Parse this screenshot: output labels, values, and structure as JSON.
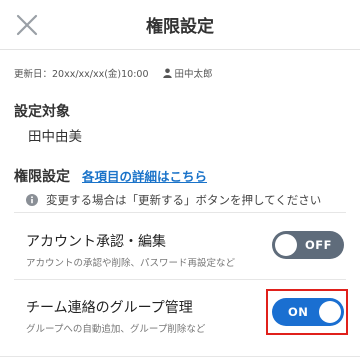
{
  "header": {
    "title": "権限設定"
  },
  "meta": {
    "updated": "更新日：20xx/xx/xx(金)10:00",
    "user": "田中太郎"
  },
  "target": {
    "label": "設定対象",
    "name": "田中由美"
  },
  "permissions": {
    "label": "権限設定",
    "detail_link": "各項目の詳細はこちら",
    "notice": "変更する場合は「更新する」ボタンを押してください",
    "items": [
      {
        "name": "アカウント承認・編集",
        "desc": "アカウントの承認や削除、パスワード再設定など",
        "state": "OFF"
      },
      {
        "name": "チーム連絡のグループ管理",
        "desc": "グループへの自動追加、グループ削除など",
        "state": "ON"
      }
    ]
  },
  "colors": {
    "toggle_on": "#1a6fd1",
    "toggle_off": "#5f6c7b",
    "link": "#1a73c9",
    "highlight": "#e0201b"
  }
}
